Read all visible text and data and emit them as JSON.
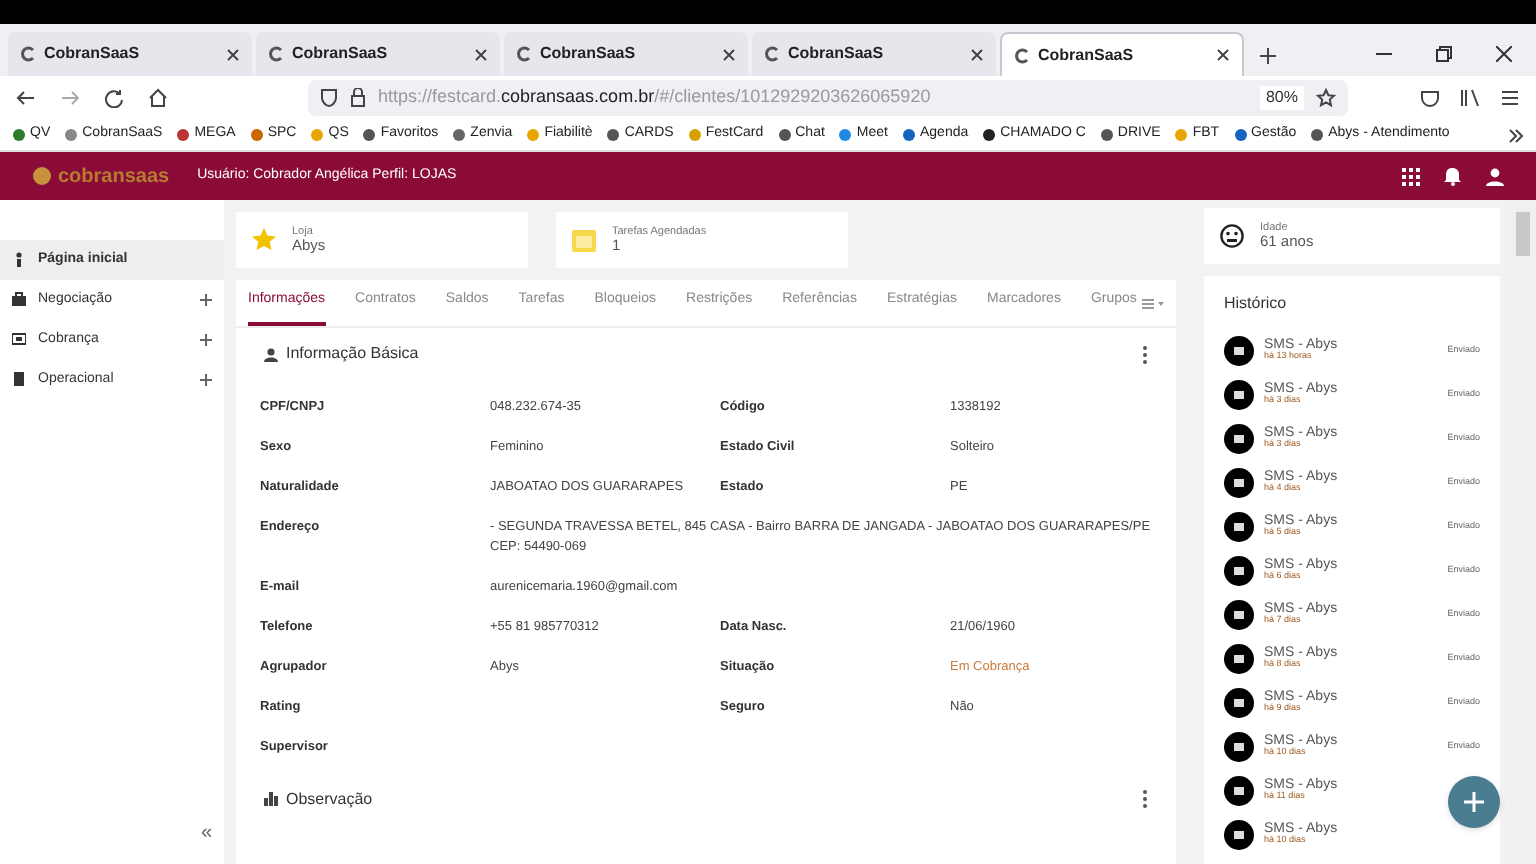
{
  "browser": {
    "tabs": [
      {
        "label": "CobranSaaS",
        "selected": false
      },
      {
        "label": "CobranSaaS",
        "selected": false
      },
      {
        "label": "CobranSaaS",
        "selected": false
      },
      {
        "label": "CobranSaaS",
        "selected": false
      },
      {
        "label": "CobranSaaS",
        "selected": true
      }
    ],
    "url_prefix": "https://festcard.",
    "url_domain": "cobransaas.com.br",
    "url_path": "/#/clientes/1012929203626065920",
    "zoom": "80%",
    "bookmarks": [
      "QV",
      "CobranSaaS",
      "MEGA",
      "SPC",
      "QS",
      "Favoritos",
      "Zenvia",
      "Fiabilitè",
      "CARDS",
      "FestCard",
      "Chat",
      "Meet",
      "Agenda",
      "CHAMADO C",
      "DRIVE",
      "FBT",
      "Gestão",
      "Abys - Atendimento"
    ]
  },
  "header": {
    "logo": "cobransaas",
    "user_label": "Usuário:",
    "user": "Cobrador Angélica",
    "profile_label": "Perfil:",
    "profile": "LOJAS"
  },
  "sidebar": {
    "items": [
      {
        "label": "Página inicial",
        "selected": true,
        "expandable": false
      },
      {
        "label": "Negociação",
        "selected": false,
        "expandable": true
      },
      {
        "label": "Cobrança",
        "selected": false,
        "expandable": true
      },
      {
        "label": "Operacional",
        "selected": false,
        "expandable": true
      }
    ],
    "collapse": "«"
  },
  "cards": [
    {
      "label": "Loja",
      "value": "Abys",
      "kind": "star"
    },
    {
      "label": "Tarefas Agendadas",
      "value": "1",
      "kind": "calendar"
    },
    {
      "label": "Idade",
      "value": "61 anos",
      "kind": "face"
    }
  ],
  "tabs": [
    {
      "label": "Informações",
      "selected": true
    },
    {
      "label": "Contratos",
      "selected": false
    },
    {
      "label": "Saldos",
      "selected": false
    },
    {
      "label": "Tarefas",
      "selected": false
    },
    {
      "label": "Bloqueios",
      "selected": false
    },
    {
      "label": "Restrições",
      "selected": false
    },
    {
      "label": "Referências",
      "selected": false
    },
    {
      "label": "Estratégias",
      "selected": false
    },
    {
      "label": "Marcadores",
      "selected": false
    },
    {
      "label": "Grupos",
      "selected": false
    }
  ],
  "section_title": "Informação Básica",
  "fields": [
    {
      "label": "CPF/CNPJ",
      "value": "048.232.674-35"
    },
    {
      "label": "Código",
      "value": "1338192"
    },
    {
      "label": "Sexo",
      "value": "Feminino"
    },
    {
      "label": "Estado Civil",
      "value": "Solteiro"
    },
    {
      "label": "Naturalidade",
      "value": "JABOATAO DOS GUARARAPES"
    },
    {
      "label": "Estado",
      "value": "PE"
    },
    {
      "label": "Endereço",
      "value": "- SEGUNDA TRAVESSA BETEL, 845 CASA - Bairro BARRA DE JANGADA - JABOATAO DOS GUARARAPES/PE CEP: 54490-069",
      "wide": true
    },
    {
      "label": "E-mail",
      "value": "aurenicemaria.1960@gmail.com",
      "wide": true
    },
    {
      "label": "Telefone",
      "value": "+55 81 985770312"
    },
    {
      "label": "Data Nasc.",
      "value": "21/06/1960"
    },
    {
      "label": "Agrupador",
      "value": "Abys"
    },
    {
      "label": "Situação",
      "value": "Em Cobrança",
      "highlight": true
    },
    {
      "label": "Rating"
    },
    {
      "label": "Seguro",
      "value": "Não"
    },
    {
      "label": "Supervisor"
    }
  ],
  "observation_title": "Observação",
  "history": {
    "title": "Histórico",
    "items": [
      {
        "title": "SMS - Abys",
        "time": "há 13 horas",
        "status": "Enviado"
      },
      {
        "title": "SMS - Abys",
        "time": "há 3 dias",
        "status": "Enviado"
      },
      {
        "title": "SMS - Abys",
        "time": "há 3 dias",
        "status": "Enviado"
      },
      {
        "title": "SMS - Abys",
        "time": "há 4 dias",
        "status": "Enviado"
      },
      {
        "title": "SMS - Abys",
        "time": "há 5 dias",
        "status": "Enviado"
      },
      {
        "title": "SMS - Abys",
        "time": "há 6 dias",
        "status": "Enviado"
      },
      {
        "title": "SMS - Abys",
        "time": "há 7 dias",
        "status": "Enviado"
      },
      {
        "title": "SMS - Abys",
        "time": "há 8 dias",
        "status": "Enviado"
      },
      {
        "title": "SMS - Abys",
        "time": "há 9 dias",
        "status": "Enviado"
      },
      {
        "title": "SMS - Abys",
        "time": "há 10 dias",
        "status": "Enviado"
      },
      {
        "title": "SMS - Abys",
        "time": "há 11 dias"
      },
      {
        "title": "SMS - Abys",
        "time": "há 10 dias"
      }
    ]
  }
}
